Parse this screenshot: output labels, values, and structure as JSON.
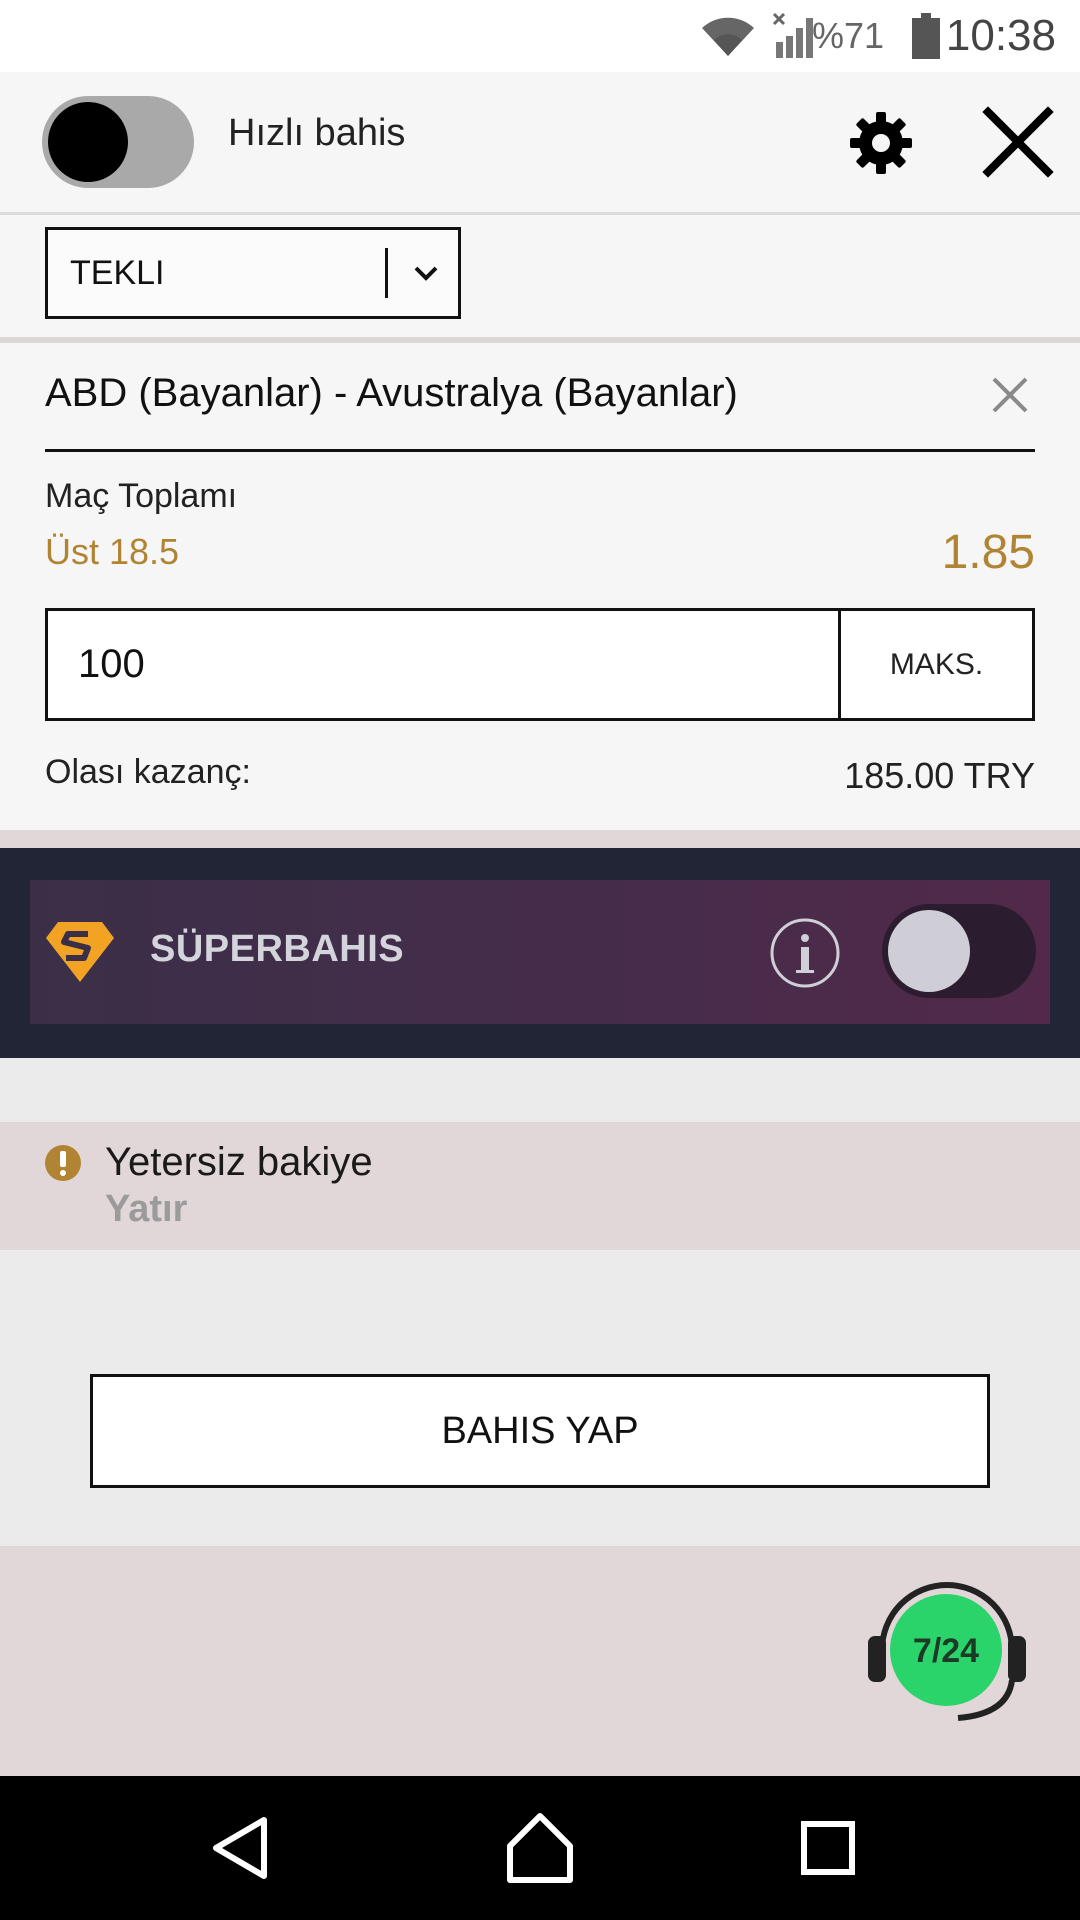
{
  "status_bar": {
    "time": "10:38",
    "battery_percent": "%71",
    "icons": [
      "wifi-icon",
      "signal-icon",
      "battery-icon"
    ]
  },
  "header": {
    "quick_bet_label": "Hızlı bahis",
    "quick_bet_on": false,
    "icons": [
      "settings-gear-icon",
      "close-icon"
    ]
  },
  "bet_type_select": {
    "selected": "TEKLI"
  },
  "bet_card": {
    "match": "ABD (Bayanlar) - Avustralya (Bayanlar)",
    "market": "Maç Toplamı",
    "selection": "Üst 18.5",
    "odds": "1.85",
    "stake_value": "100",
    "max_label": "MAKS.",
    "potential_win_label": "Olası kazanç:",
    "potential_win_value": "185.00 TRY"
  },
  "superbahis": {
    "title": "SÜPERBAHIS",
    "enabled": false,
    "icons": [
      "superbahis-logo-icon",
      "info-icon"
    ]
  },
  "warning": {
    "message": "Yetersiz bakiye",
    "link": "Yatır"
  },
  "place_bet_label": "BAHIS YAP",
  "support_badge": "7/24",
  "colors": {
    "accent_gold": "#b08433",
    "superbahis_dark": "#212535",
    "support_green": "#2bd46a"
  }
}
